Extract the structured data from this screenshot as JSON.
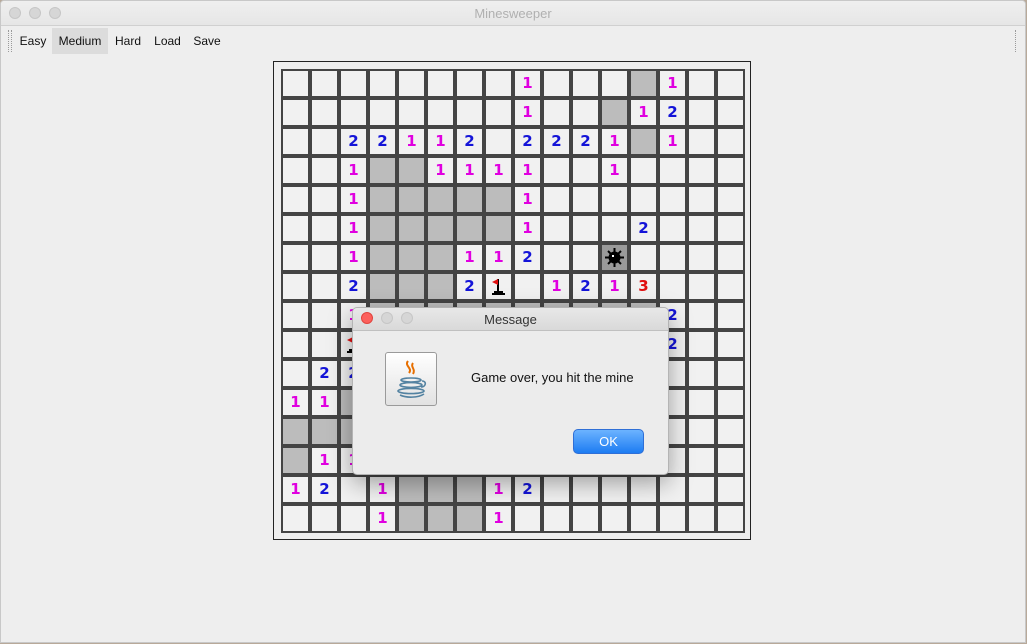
{
  "window": {
    "title": "Minesweeper"
  },
  "toolbar": {
    "items": [
      {
        "label": "Easy"
      },
      {
        "label": "Medium",
        "selected": true
      },
      {
        "label": "Hard"
      },
      {
        "label": "Load"
      },
      {
        "label": "Save"
      }
    ]
  },
  "board": {
    "columns": 16,
    "rows": 16,
    "legend": {
      ".": "unrevealed",
      "_": "revealed empty",
      "1-3": "adjacent mine count",
      "F": "flag",
      "M": "mine (hit)"
    },
    "cells": [
      "________1___.1_",
      "________1__.12_",
      "__22112_2221.1_",
      "__1..1111__1___",
      "__1.....1______",
      "__1.....1___2__",
      "__1...112__M___",
      "__2...2F_1213__",
      "__1..........2__",
      "__F..........2__",
      "_22.........____",
      "11..........____",
      "..._........____",
      ".11.........____",
      "12_1...12_______",
      "___1...1________"
    ]
  },
  "dialog": {
    "title": "Message",
    "message": "Game over, you hit the mine",
    "ok_label": "OK",
    "icon": "java-coffee-cup-icon"
  },
  "colors": {
    "one": "#e000e0",
    "two": "#1414d8",
    "three": "#e01010",
    "ok_button": "#1d7cf2"
  }
}
